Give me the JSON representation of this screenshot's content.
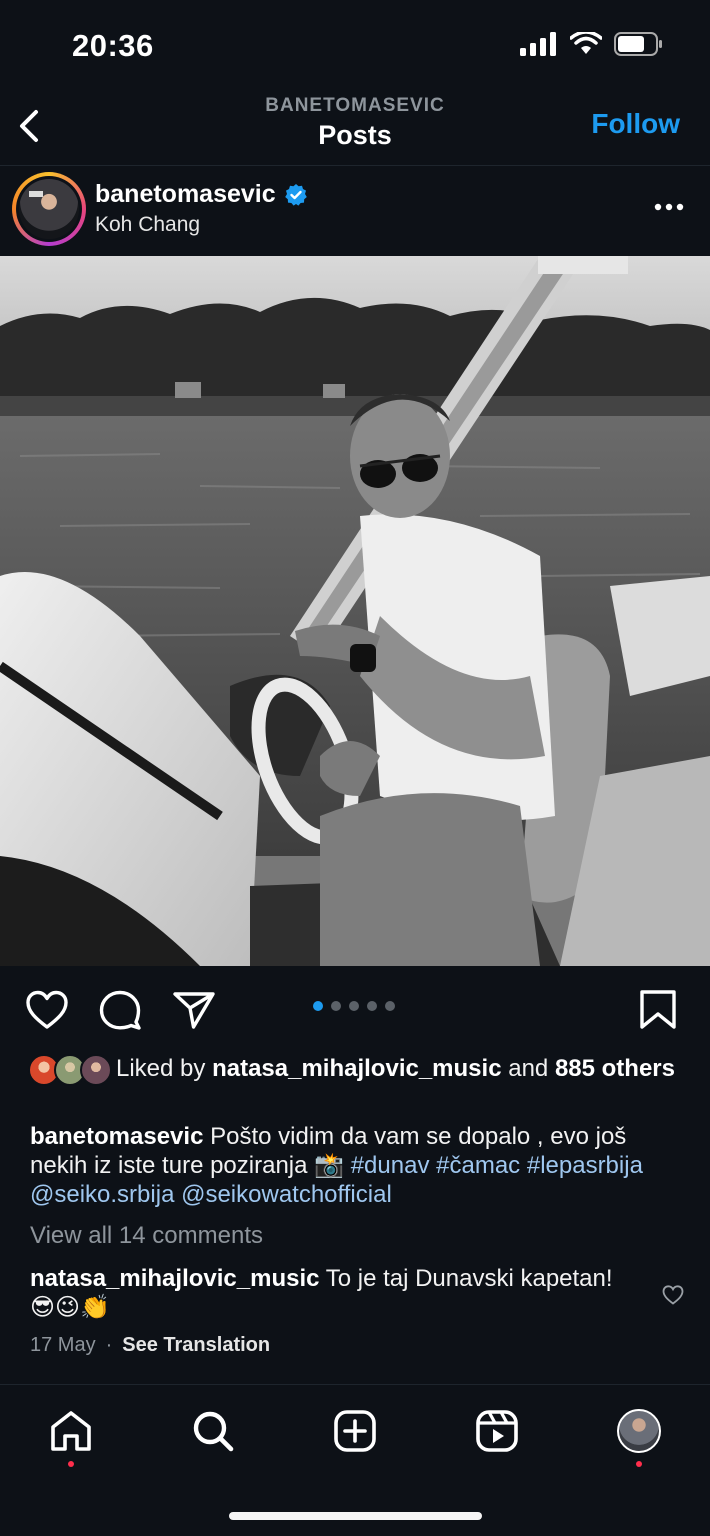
{
  "status_bar": {
    "time": "20:36"
  },
  "nav": {
    "subtitle": "BANETOMASEVIC",
    "title": "Posts",
    "follow_label": "Follow"
  },
  "post": {
    "username": "banetomasevic",
    "verified": true,
    "location": "Koh Chang",
    "carousel": {
      "count": 5,
      "active_index": 0
    },
    "likes": {
      "prefix": "Liked by",
      "top_liker": "natasa_mihajlovic_music",
      "connector": "and",
      "others": "885 others"
    },
    "caption": {
      "username": "banetomasevic",
      "text": "Pošto vidim da vam se dopalo , evo još nekih iz iste ture poziranja 📸",
      "hashtags": [
        "#dunav",
        "#čamac",
        "#lepasrbija"
      ],
      "mentions": [
        "@seiko.srbija",
        "@seikowatchofficial"
      ]
    },
    "view_comments": "View all 14 comments",
    "top_comment": {
      "username": "natasa_mihajlovic_music",
      "text": "To je taj Dunavski kapetan!😎😉👏"
    },
    "date": "17 May",
    "separator": "·",
    "see_translation": "See Translation"
  },
  "colors": {
    "accent": "#1d9bf0",
    "background": "#0d1117",
    "notification_dot": "#ff2e4c",
    "hashtag": "#9fc7ef"
  },
  "icons": {
    "nav": [
      "back-icon"
    ],
    "actions": [
      "heart-icon",
      "comment-icon",
      "share-icon",
      "bookmark-icon"
    ],
    "tabs": [
      "home-icon",
      "search-icon",
      "create-icon",
      "reels-icon",
      "profile-avatar"
    ]
  }
}
